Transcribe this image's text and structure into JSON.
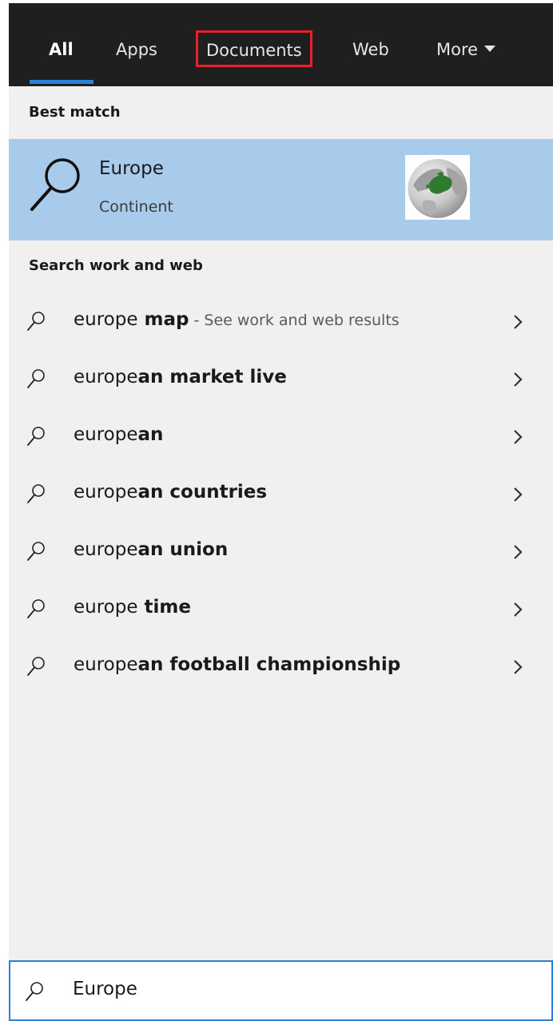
{
  "tabs": {
    "all": "All",
    "apps": "Apps",
    "documents": "Documents",
    "web": "Web",
    "more": "More"
  },
  "best_match": {
    "header": "Best match",
    "title": "Europe",
    "subtitle": "Continent",
    "icon": "search-icon",
    "thumbnail": "europe-globe-image"
  },
  "search_web": {
    "header": "Search work and web",
    "items": [
      {
        "query": "europe",
        "completion": " map",
        "hint": " - See work and web results"
      },
      {
        "query": "europe",
        "completion": "an market live",
        "hint": ""
      },
      {
        "query": "europe",
        "completion": "an",
        "hint": ""
      },
      {
        "query": "europe",
        "completion": "an countries",
        "hint": ""
      },
      {
        "query": "europe",
        "completion": "an union",
        "hint": ""
      },
      {
        "query": "europe",
        "completion": " time",
        "hint": ""
      },
      {
        "query": "europe",
        "completion": "an football championship",
        "hint": ""
      }
    ]
  },
  "search_box": {
    "value": "Europe"
  },
  "colors": {
    "tab_bar": "#1f1f1f",
    "accent": "#2b82d9",
    "highlight_box": "#e8202a",
    "best_match_bg": "#a8cbeb",
    "panel_bg": "#f0f0f0"
  }
}
